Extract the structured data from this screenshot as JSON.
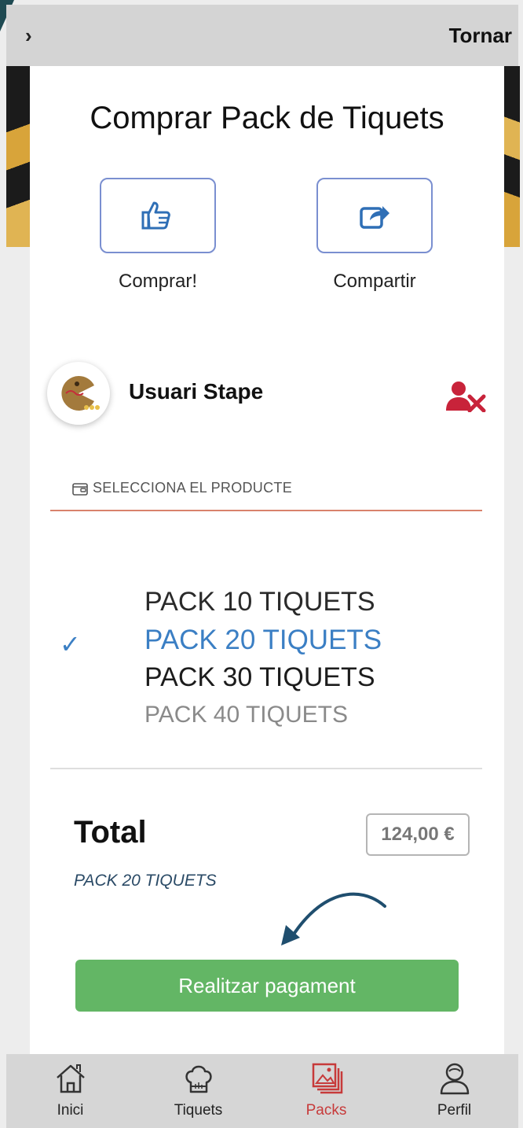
{
  "header": {
    "chevron": "›",
    "back_label": "Tornar"
  },
  "page": {
    "title": "Comprar Pack de Tiquets"
  },
  "actions": {
    "buy_label": "Comprar!",
    "share_label": "Compartir",
    "buy_icon": "thumbs-up-icon",
    "share_icon": "share-icon"
  },
  "user": {
    "name": "Usuari Stape",
    "remove_icon": "user-remove-icon"
  },
  "product_select": {
    "label": "SELECCIONA EL PRODUCTE",
    "options": [
      "PACK 10 TIQUETS",
      "PACK 20 TIQUETS",
      "PACK 30 TIQUETS",
      "PACK 40 TIQUETS"
    ],
    "selected": "PACK 20 TIQUETS",
    "check": "✓"
  },
  "total": {
    "label": "Total",
    "price": "124,00 €",
    "pack": "PACK 20 TIQUETS"
  },
  "pay_button": {
    "label": "Realitzar pagament"
  },
  "nav": {
    "items": [
      {
        "label": "Inici",
        "icon": "home-icon"
      },
      {
        "label": "Tiquets",
        "icon": "chef-hat-icon"
      },
      {
        "label": "Packs",
        "icon": "gallery-icon"
      },
      {
        "label": "Perfil",
        "icon": "user-icon"
      }
    ],
    "active": "Packs"
  },
  "colors": {
    "accent_blue": "#3b7fc4",
    "pay_green": "#63b665",
    "active_red": "#c73a3a",
    "remove_red": "#c8233a"
  }
}
